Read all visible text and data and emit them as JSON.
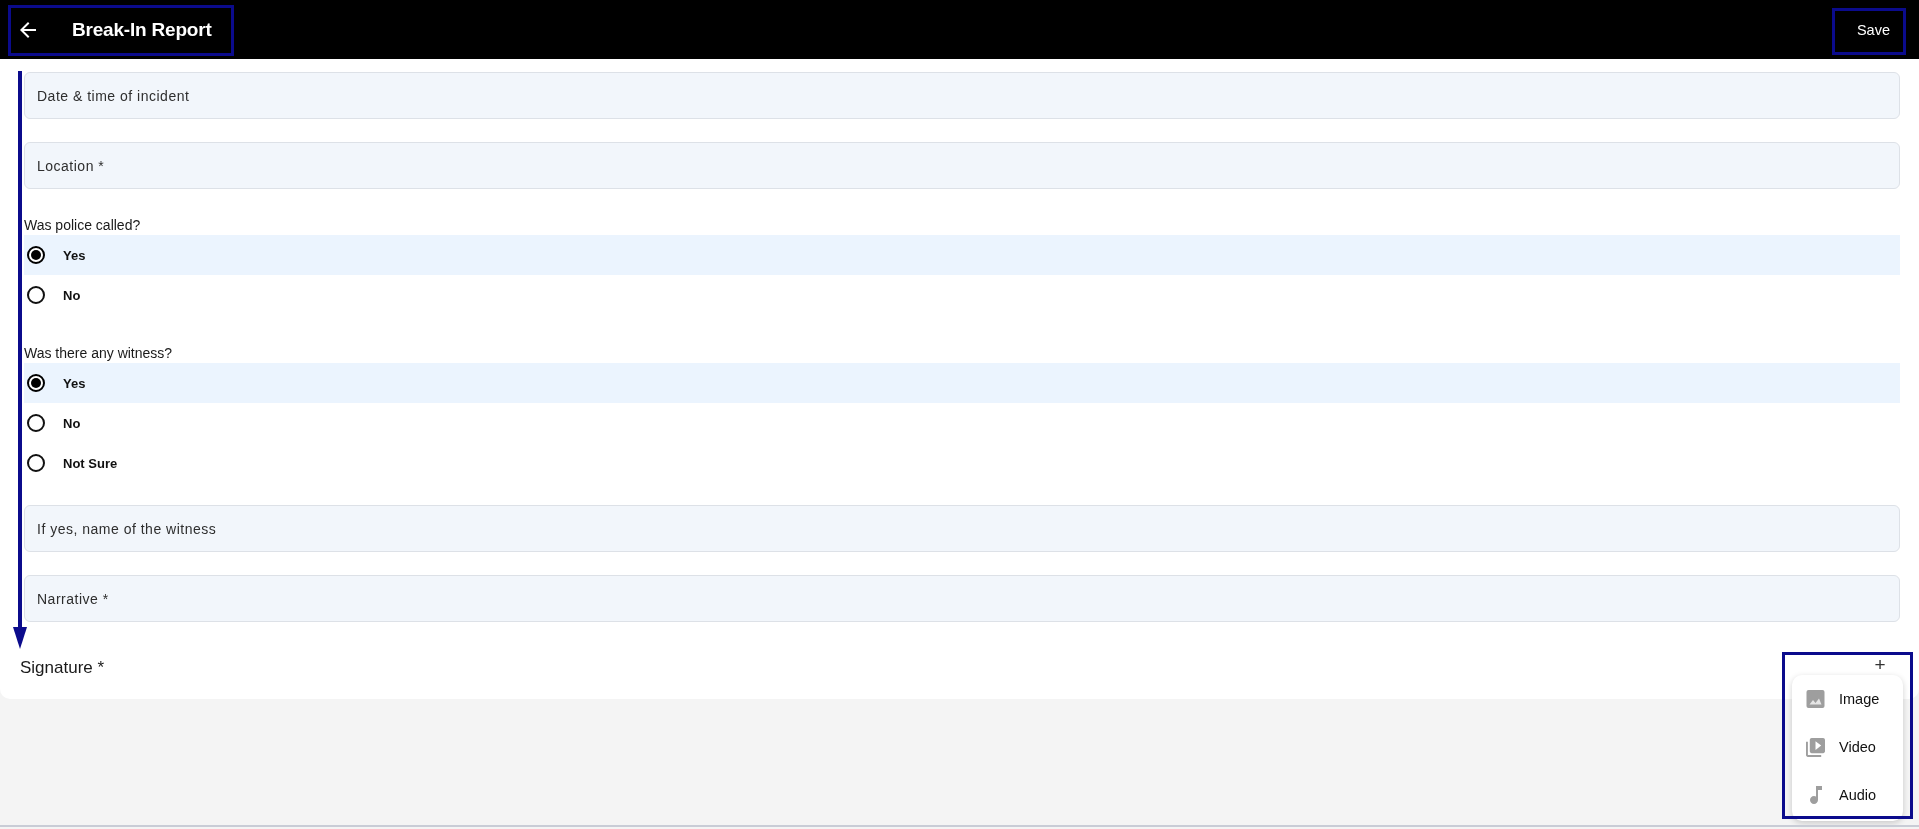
{
  "header": {
    "title": "Break-In Report",
    "save_label": "Save"
  },
  "form": [
    {
      "kind": "text_field",
      "placeholder": "Date & time of incident"
    },
    {
      "kind": "text_field",
      "placeholder": "Location *"
    },
    {
      "kind": "radio_group",
      "question": "Was police called?",
      "options": [
        {
          "label": "Yes",
          "selected": true
        },
        {
          "label": "No",
          "selected": false
        }
      ]
    },
    {
      "kind": "radio_group",
      "question": "Was there any witness?",
      "options": [
        {
          "label": "Yes",
          "selected": true
        },
        {
          "label": "No",
          "selected": false
        },
        {
          "label": "Not Sure",
          "selected": false
        }
      ]
    },
    {
      "kind": "text_field",
      "placeholder": "If yes, name of the witness"
    },
    {
      "kind": "text_field",
      "placeholder": "Narrative *"
    },
    {
      "kind": "signature",
      "label": "Signature *"
    }
  ],
  "add_button": {
    "label": "+"
  },
  "attach_menu": {
    "items": [
      {
        "kind": "image",
        "label": "Image"
      },
      {
        "kind": "video",
        "label": "Video"
      },
      {
        "kind": "audio",
        "label": "Audio"
      }
    ]
  }
}
